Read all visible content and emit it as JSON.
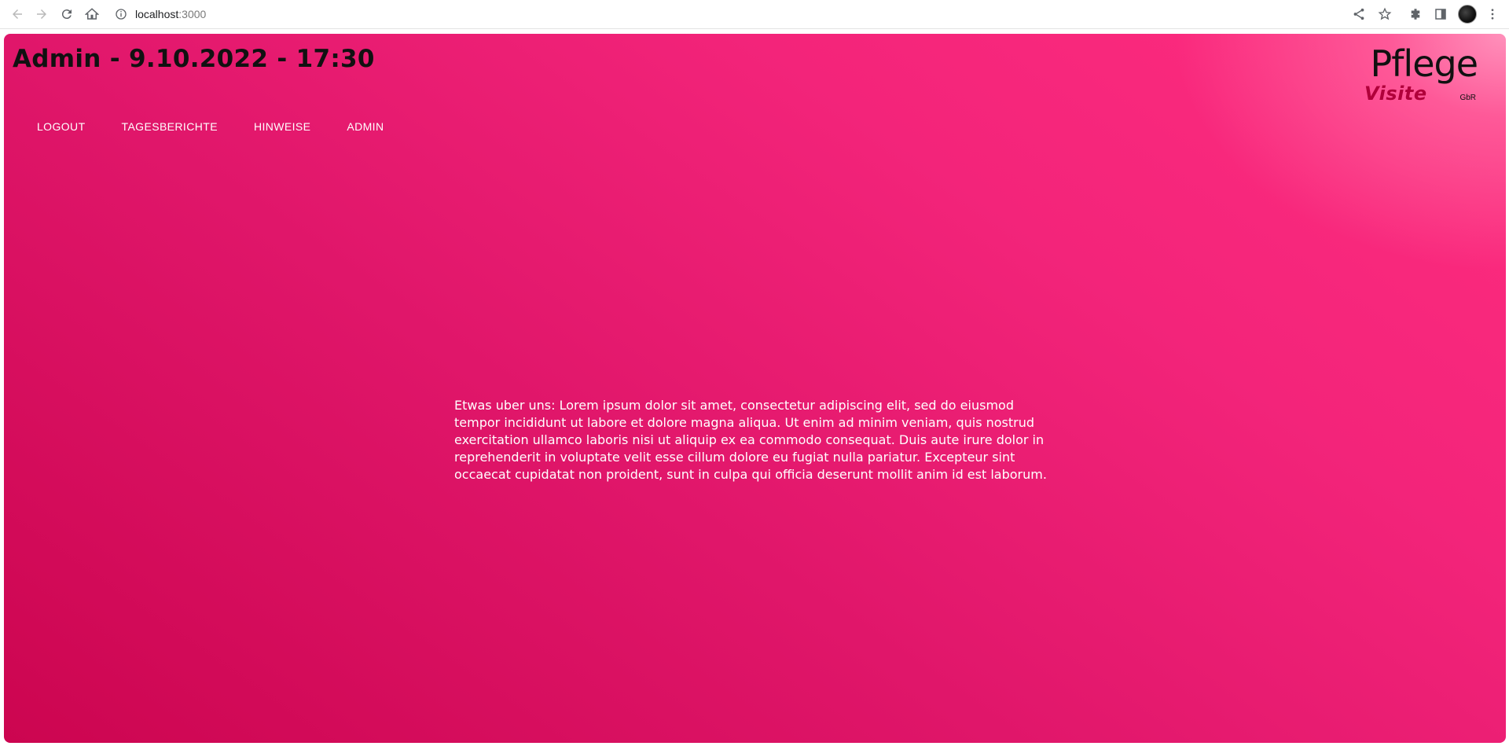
{
  "browser": {
    "url_host": "localhost",
    "url_port": ":3000"
  },
  "app": {
    "title": "Admin - 9.10.2022 - 17:30",
    "nav": [
      {
        "label": "LOGOUT"
      },
      {
        "label": "TAGESBERICHTE"
      },
      {
        "label": "HINWEISE"
      },
      {
        "label": "ADMIN"
      }
    ],
    "logo": {
      "word_top": "Pflege",
      "word_bottom": "Visite",
      "suffix": "GbR"
    },
    "about_text": "Etwas uber uns: Lorem ipsum dolor sit amet, consectetur adipiscing elit, sed do eiusmod tempor incididunt ut labore et dolore magna aliqua. Ut enim ad minim veniam, quis nostrud exercitation ullamco laboris nisi ut aliquip ex ea commodo consequat. Duis aute irure dolor in reprehenderit in voluptate velit esse cillum dolore eu fugiat nulla pariatur. Excepteur sint occaecat cupidatat non proident, sunt in culpa qui officia deserunt mollit anim id est laborum."
  },
  "colors": {
    "accent_dark": "#cc0550",
    "accent_light": "#ff2d7f",
    "logo_visite": "#b0003a"
  }
}
